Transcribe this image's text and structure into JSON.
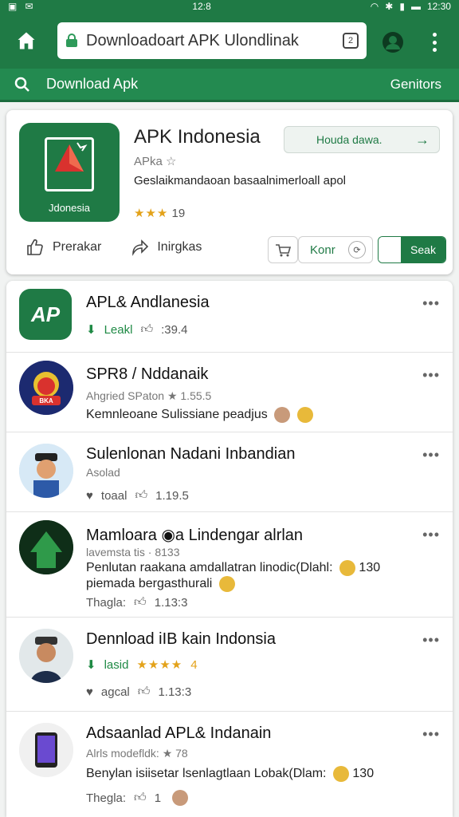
{
  "status": {
    "time": "12:8",
    "right_time": "12:30"
  },
  "browser": {
    "url": "Downloadoart APK Ulondlinak",
    "tab_count": "2"
  },
  "searchbar": {
    "label": "Download Apk",
    "right": "Genitors"
  },
  "hero": {
    "title": "APK Indonesia",
    "developer": "APka ☆",
    "description": "Geslaikmandaoan basaalnimerloall apol",
    "rating": "19",
    "logo_text": "Jdonesia",
    "install_label": "Houda dawa.",
    "action1": "Prerakar",
    "action2": "Inirgkas",
    "chip_label": "Konr",
    "toggle_label": "Seak"
  },
  "apps": [
    {
      "title": "APL& Andlanesia",
      "meta": "Leakl",
      "count": ":39.4",
      "logo": "AP"
    },
    {
      "title": "SPR8 / Nddanaik",
      "meta": "Ahgried SPaton ★ 1.55.5",
      "desc": "Kemnleoane Sulissiane peadjus",
      "badge": "BKA"
    },
    {
      "title": "Sulenlonan Nadani Inbandian",
      "meta": "Asolad",
      "stat1": "toaal",
      "stat2": "1.19.5"
    },
    {
      "title": "Mamloara ◉a Lindengar alrlan",
      "meta": "lavemsta tis · 8133",
      "desc1": "Penlutan raakana amdallatran linodic(Dlahl:",
      "desc1_num": "130",
      "desc2": "piemada bergasthurali",
      "stat1": "Thagla:",
      "stat2": "1.13:3"
    },
    {
      "title": "Dennload iIB kain Indonsia",
      "meta": "lasid",
      "rating": "4",
      "stat1": "agcal",
      "stat2": "1.13:3"
    },
    {
      "title": "Adsaanlad APL& Indanain",
      "meta": "Alrls modefldk: ★ 78",
      "desc": "Benylan isiisetar lsenlagtlaan Lobak(Dlam:",
      "desc_num": "130",
      "stat1": "Thegla:",
      "stat2": "1"
    }
  ],
  "colors": {
    "brand": "#1f7a45",
    "accent_green": "#1f8a45",
    "star": "#e3a21a"
  }
}
